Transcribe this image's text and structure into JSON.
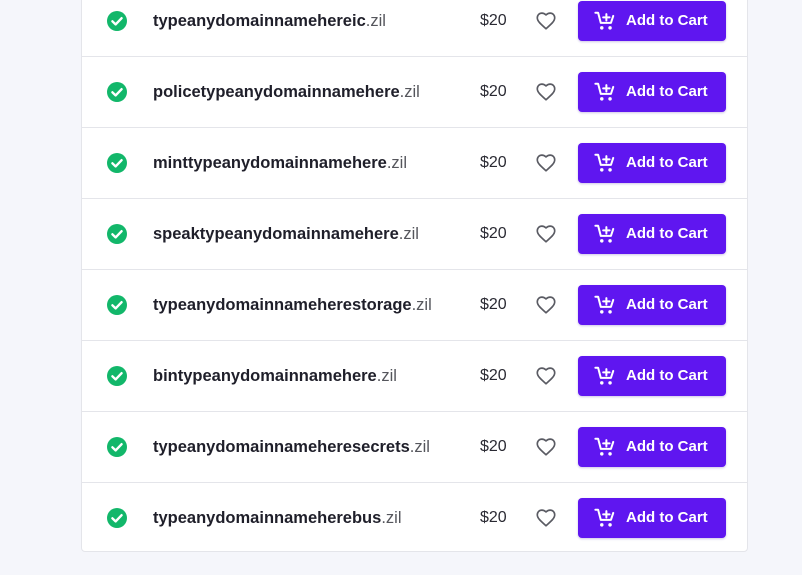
{
  "colors": {
    "accent": "#5f16f0",
    "available": "#12b76a",
    "page_bg": "#f5f6fb"
  },
  "icons": {
    "available": "check-circle-icon",
    "favorite": "heart-outline-icon",
    "cart": "cart-add-icon"
  },
  "results": [
    {
      "name": "typeanydomainnamehereic",
      "tld": ".zil",
      "price": "$20",
      "button": "Add to Cart"
    },
    {
      "name": "policetypeanydomainnamehere",
      "tld": ".zil",
      "price": "$20",
      "button": "Add to Cart"
    },
    {
      "name": "minttypeanydomainnamehere",
      "tld": ".zil",
      "price": "$20",
      "button": "Add to Cart"
    },
    {
      "name": "speaktypeanydomainnamehere",
      "tld": ".zil",
      "price": "$20",
      "button": "Add to Cart"
    },
    {
      "name": "typeanydomainnameherestorage",
      "tld": ".zil",
      "price": "$20",
      "button": "Add to Cart"
    },
    {
      "name": "bintypeanydomainnamehere",
      "tld": ".zil",
      "price": "$20",
      "button": "Add to Cart"
    },
    {
      "name": "typeanydomainnameheresecrets",
      "tld": ".zil",
      "price": "$20",
      "button": "Add to Cart"
    },
    {
      "name": "typeanydomainnameherebus",
      "tld": ".zil",
      "price": "$20",
      "button": "Add to Cart"
    }
  ]
}
